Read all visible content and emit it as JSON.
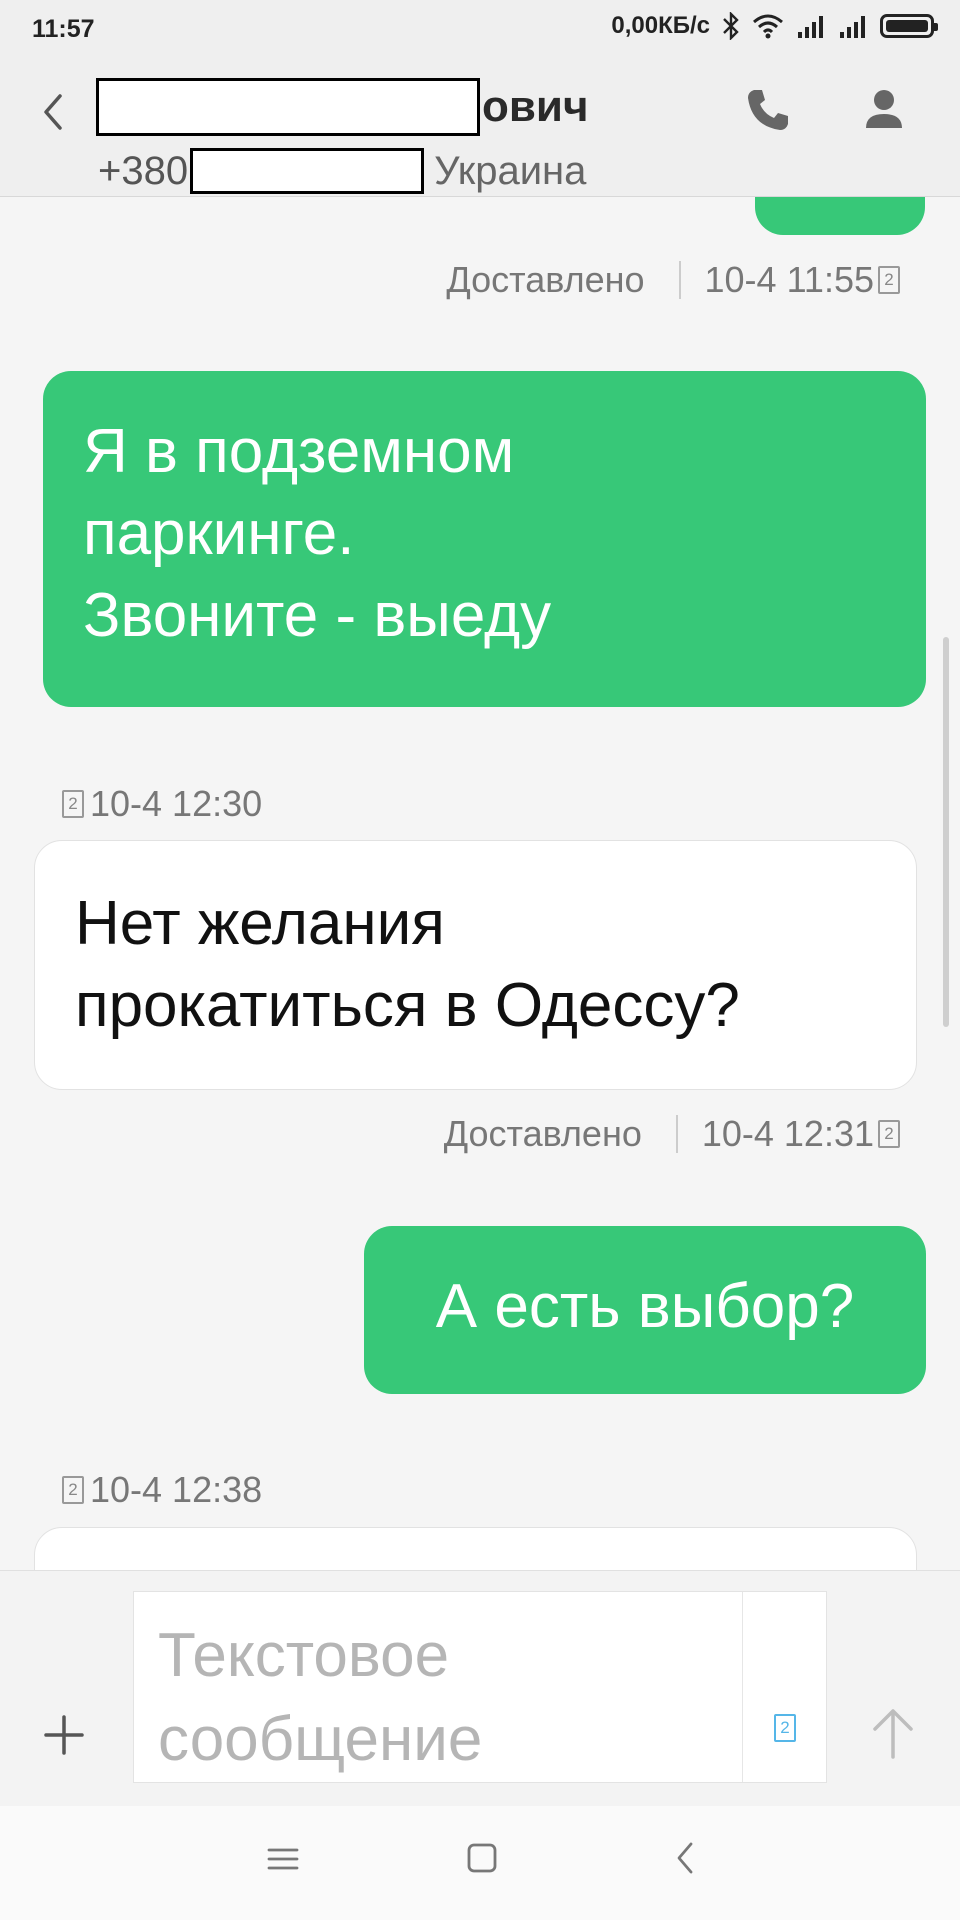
{
  "status_bar": {
    "time": "11:57",
    "network_speed": "0,00КБ/с",
    "icons": [
      "bluetooth-icon",
      "wifi-icon",
      "signal-icon",
      "signal-icon",
      "battery-icon"
    ]
  },
  "header": {
    "name_suffix": "ович",
    "phone_prefix": "+380",
    "location": "Украина",
    "back_icon": "chevron-left-icon",
    "call_icon": "phone-icon",
    "contact_icon": "person-icon"
  },
  "messages": [
    {
      "direction": "outgoing",
      "status": "Доставлено",
      "timestamp": "10-4 11:55",
      "sim": "2",
      "text": "Я в подземном\nпаркинге.\nЗвоните - выеду"
    },
    {
      "direction": "incoming",
      "timestamp": "10-4 12:30",
      "sim": "2",
      "text": "Нет желания\nпрокатиться в Одессу?"
    },
    {
      "direction": "outgoing",
      "status": "Доставлено",
      "timestamp": "10-4 12:31",
      "sim": "2",
      "text": "А есть выбор?"
    },
    {
      "direction": "incoming",
      "timestamp": "10-4 12:38",
      "sim": "2",
      "text": ""
    }
  ],
  "compose": {
    "placeholder": "Текстовое сообщение",
    "sim": "2",
    "attach_icon": "plus-icon",
    "send_icon": "arrow-up-icon"
  },
  "navbar": {
    "icons": [
      "menu-icon",
      "home-square-icon",
      "back-chevron-icon"
    ]
  },
  "colors": {
    "outgoing_bubble": "#37c878",
    "incoming_bubble": "#ffffff",
    "background": "#f5f5f5",
    "accent_sim": "#55b6e8"
  }
}
